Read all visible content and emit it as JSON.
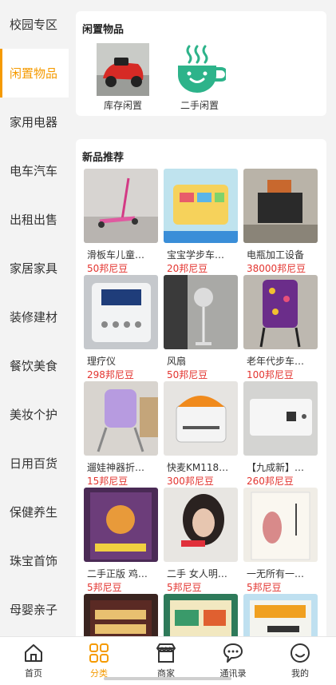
{
  "sidebar": {
    "items": [
      {
        "label": "校园专区",
        "active": false
      },
      {
        "label": "闲置物品",
        "active": true
      },
      {
        "label": "家用电器",
        "active": false
      },
      {
        "label": "电车汽车",
        "active": false
      },
      {
        "label": "出租出售",
        "active": false
      },
      {
        "label": "家居家具",
        "active": false
      },
      {
        "label": "装修建材",
        "active": false
      },
      {
        "label": "餐饮美食",
        "active": false
      },
      {
        "label": "美妆个护",
        "active": false
      },
      {
        "label": "日用百货",
        "active": false
      },
      {
        "label": "保健养生",
        "active": false
      },
      {
        "label": "珠宝首饰",
        "active": false
      },
      {
        "label": "母婴亲子",
        "active": false
      }
    ]
  },
  "idle": {
    "title": "闲置物品",
    "categories": [
      {
        "label": "库存闲置",
        "icon": "toy-car-photo"
      },
      {
        "label": "二手闲置",
        "icon": "coffee-cup-icon"
      }
    ]
  },
  "new_products": {
    "title": "新品推荐",
    "items": [
      {
        "name": "滑板车儿童…",
        "price": "50邦尼豆",
        "thumb": "scooter"
      },
      {
        "name": "宝宝学步车…",
        "price": "20邦尼豆",
        "thumb": "walker"
      },
      {
        "name": "电瓶加工设备",
        "price": "38000邦尼豆",
        "thumb": "machine"
      },
      {
        "name": "理疗仪",
        "price": "298邦尼豆",
        "thumb": "therapy"
      },
      {
        "name": "风扇",
        "price": "50邦尼豆",
        "thumb": "fan"
      },
      {
        "name": "老年代步车…",
        "price": "100邦尼豆",
        "thumb": "stroller"
      },
      {
        "name": "遛娃神器折…",
        "price": "15邦尼豆",
        "thumb": "babycart"
      },
      {
        "name": "快麦KM118…",
        "price": "300邦尼豆",
        "thumb": "printer"
      },
      {
        "name": "【九成新】…",
        "price": "260邦尼豆",
        "thumb": "whitebox"
      },
      {
        "name": "二手正版 鸡…",
        "price": "5邦尼豆",
        "thumb": "book1"
      },
      {
        "name": "二手 女人明…",
        "price": "5邦尼豆",
        "thumb": "book2"
      },
      {
        "name": "一无所有一…",
        "price": "5邦尼豆",
        "thumb": "book3"
      },
      {
        "name": "",
        "price": "",
        "thumb": "book4"
      },
      {
        "name": "",
        "price": "",
        "thumb": "book5"
      },
      {
        "name": "",
        "price": "",
        "thumb": "book6"
      }
    ]
  },
  "tabbar": {
    "tabs": [
      {
        "label": "首页",
        "icon": "home-icon"
      },
      {
        "label": "分类",
        "icon": "category-icon",
        "active": true
      },
      {
        "label": "商家",
        "icon": "shop-icon"
      },
      {
        "label": "通讯录",
        "icon": "chat-icon"
      },
      {
        "label": "我的",
        "icon": "profile-icon"
      }
    ]
  },
  "colors": {
    "accent": "#f59a00",
    "price": "#e3342f",
    "icon_green": "#2db38a"
  }
}
